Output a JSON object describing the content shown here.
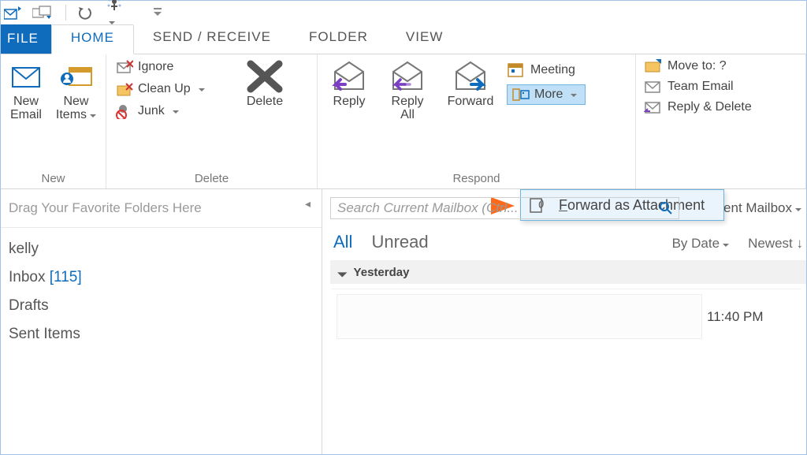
{
  "tabs": {
    "file": "FILE",
    "home": "HOME",
    "sendreceive": "SEND / RECEIVE",
    "folder": "FOLDER",
    "view": "VIEW"
  },
  "ribbon": {
    "new": {
      "label": "New",
      "new_email": "New\nEmail",
      "new_items": "New\nItems"
    },
    "delete": {
      "label": "Delete",
      "ignore": "Ignore",
      "cleanup": "Clean Up",
      "junk": "Junk",
      "delete_btn": "Delete"
    },
    "respond": {
      "label": "Respond",
      "reply": "Reply",
      "reply_all": "Reply\nAll",
      "forward": "Forward",
      "meeting": "Meeting",
      "more": "More"
    },
    "quicksteps": {
      "moveto": "Move to: ?",
      "team_email": "Team Email",
      "reply_delete": "Reply & Delete"
    }
  },
  "dropdown_item": "Forward as Attachment",
  "sidebar": {
    "fav_placeholder": "Drag Your Favorite Folders Here",
    "account": "kelly",
    "inbox_label": "Inbox",
    "inbox_count": "[115]",
    "drafts": "Drafts",
    "sent": "Sent Items"
  },
  "listpane": {
    "search_placeholder": "Search Current Mailbox (Ctrl...",
    "scope": "Current Mailbox",
    "all": "All",
    "unread": "Unread",
    "by_date": "By Date",
    "newest": "Newest",
    "group_yesterday": "Yesterday",
    "msg_time": "11:40 PM"
  }
}
